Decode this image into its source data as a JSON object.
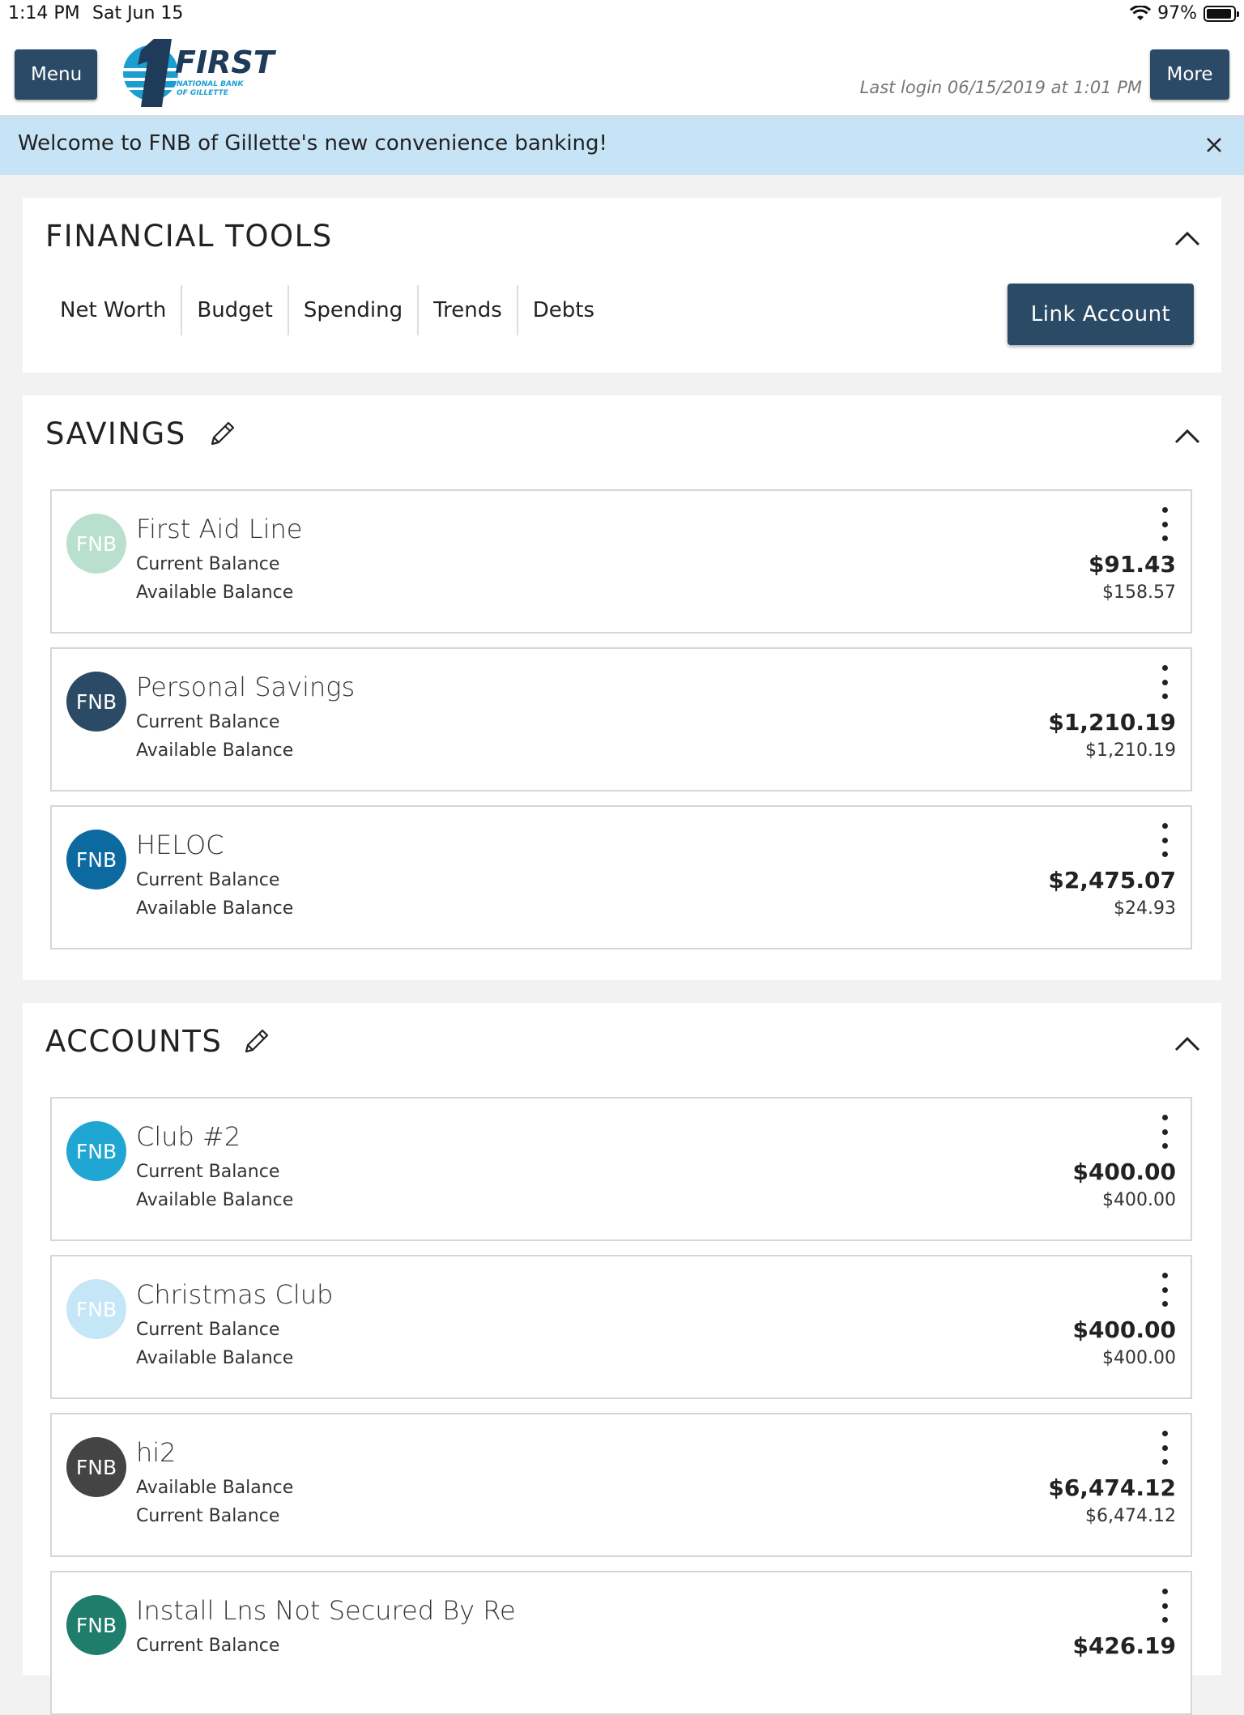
{
  "status_bar": {
    "time": "1:14 PM",
    "date": "Sat Jun 15",
    "battery": "97%"
  },
  "header": {
    "menu_label": "Menu",
    "more_label": "More",
    "last_login": "Last login 06/15/2019 at 1:01 PM",
    "logo": {
      "word": "FIRST",
      "line1": "NATIONAL BANK",
      "line2": "OF GILLETTE"
    }
  },
  "banner": {
    "text": "Welcome to FNB of Gillette's new convenience banking!"
  },
  "financial_tools": {
    "title": "FINANCIAL TOOLS",
    "tabs": [
      "Net Worth",
      "Budget",
      "Spending",
      "Trends",
      "Debts"
    ],
    "link_account_label": "Link Account"
  },
  "savings": {
    "title": "SAVINGS",
    "items": [
      {
        "avatar": "FNB",
        "avatar_color": "#b9e0cf",
        "name": "First Aid Line",
        "label1": "Current Balance",
        "label2": "Available Balance",
        "amount1": "$91.43",
        "amount2": "$158.57"
      },
      {
        "avatar": "FNB",
        "avatar_color": "#2b4a66",
        "name": "Personal Savings",
        "label1": "Current Balance",
        "label2": "Available Balance",
        "amount1": "$1,210.19",
        "amount2": "$1,210.19"
      },
      {
        "avatar": "FNB",
        "avatar_color": "#0d6aa0",
        "name": "HELOC",
        "label1": "Current Balance",
        "label2": "Available Balance",
        "amount1": "$2,475.07",
        "amount2": "$24.93"
      }
    ]
  },
  "accounts": {
    "title": "ACCOUNTS",
    "items": [
      {
        "avatar": "FNB",
        "avatar_color": "#1fa6d3",
        "name": "Club #2",
        "label1": "Current Balance",
        "label2": "Available Balance",
        "amount1": "$400.00",
        "amount2": "$400.00"
      },
      {
        "avatar": "FNB",
        "avatar_color": "#c5e6f7",
        "name": "Christmas Club",
        "label1": "Current Balance",
        "label2": "Available Balance",
        "amount1": "$400.00",
        "amount2": "$400.00"
      },
      {
        "avatar": "FNB",
        "avatar_color": "#444444",
        "name": "hi2",
        "label1": "Available Balance",
        "label2": "Current Balance",
        "amount1": "$6,474.12",
        "amount2": "$6,474.12"
      },
      {
        "avatar": "FNB",
        "avatar_color": "#1f7d6c",
        "name": "Install Lns Not Secured By Re",
        "label1": "Current Balance",
        "label2": "",
        "amount1": "$426.19",
        "amount2": ""
      }
    ]
  },
  "icons": {
    "wifi": "wifi-icon",
    "battery": "battery-icon",
    "close": "close-icon",
    "collapse": "chevron-up-icon",
    "edit": "pencil-icon",
    "more": "kebab-icon"
  }
}
